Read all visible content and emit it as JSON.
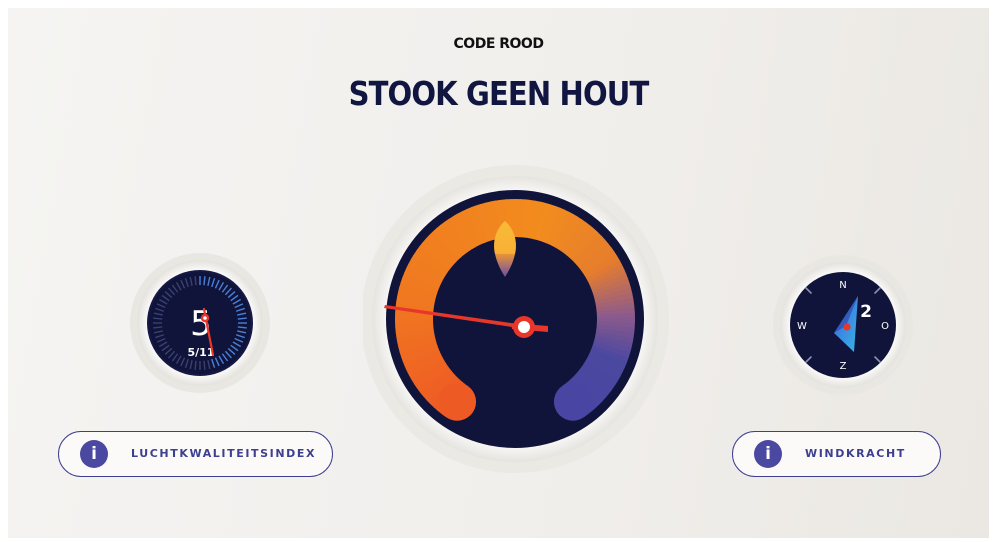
{
  "header": {
    "code": "CODE ROOD",
    "advice": "STOOK GEEN HOUT"
  },
  "air_quality": {
    "value": "5",
    "scale_text": "5/11",
    "level": 5,
    "max": 11
  },
  "wind": {
    "force": "2",
    "compass": {
      "north": "N",
      "east": "O",
      "south": "Z",
      "west": "W"
    }
  },
  "main_gauge": {
    "icon": "flame-icon"
  },
  "buttons": {
    "air_quality_label": "LUCHTKWALITEITSINDEX",
    "wind_label": "WINDKRACHT"
  },
  "colors": {
    "navy": "#11143a",
    "orange": "#f18a1c",
    "red_orange": "#ee5a24",
    "indigo": "#4a48a0",
    "needle_red": "#e8362b",
    "title": "#101640"
  }
}
